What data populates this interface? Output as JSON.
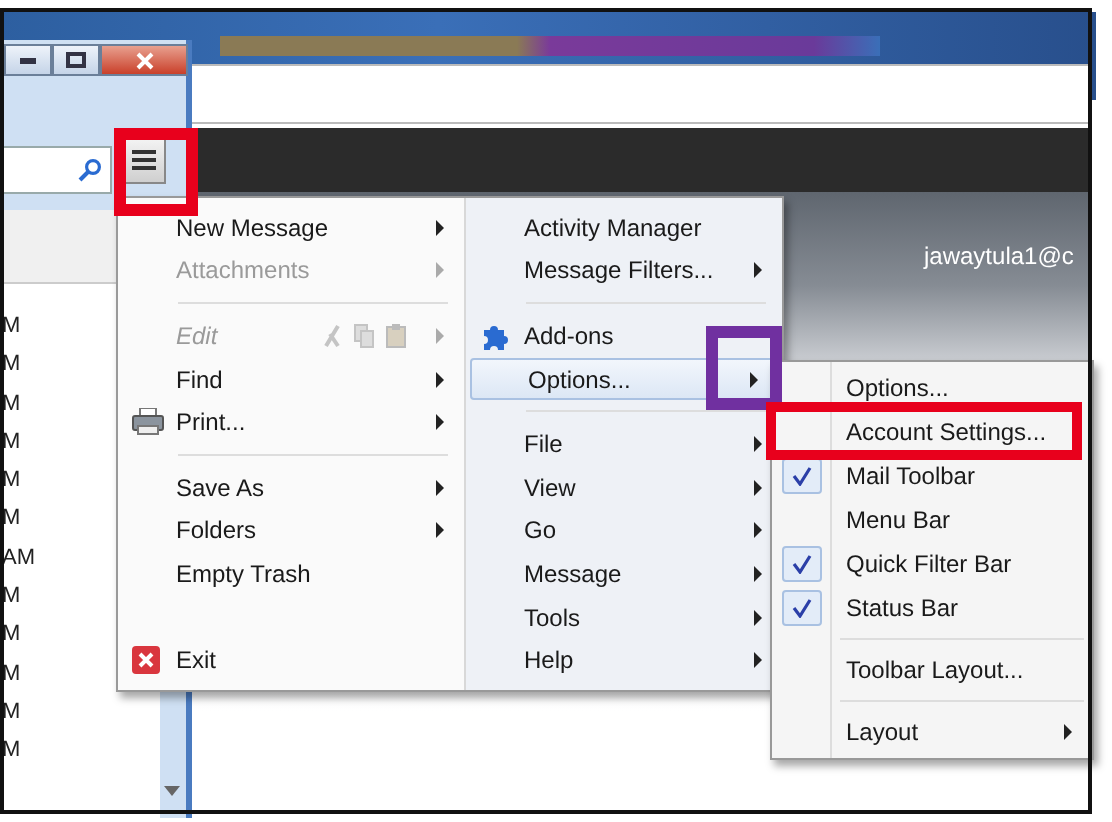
{
  "account_label": "jawaytula1@c",
  "message_list": {
    "rows": [
      "M",
      "M",
      "M",
      "M",
      "M",
      "M",
      "AM",
      "M",
      "M",
      "M",
      "M",
      "M"
    ]
  },
  "menu": {
    "left": [
      {
        "kind": "item",
        "label": "New Message",
        "arrow": true,
        "disabled": false,
        "selected": false
      },
      {
        "kind": "item",
        "label": "Attachments",
        "arrow": true,
        "disabled": true,
        "selected": false
      },
      {
        "kind": "separator"
      },
      {
        "kind": "edit",
        "label": "Edit",
        "arrow": true,
        "disabled": true,
        "selected": false
      },
      {
        "kind": "item",
        "label": "Find",
        "arrow": true,
        "disabled": false,
        "selected": false
      },
      {
        "kind": "print",
        "label": "Print...",
        "arrow": true,
        "disabled": false,
        "selected": false
      },
      {
        "kind": "separator"
      },
      {
        "kind": "item",
        "label": "Save As",
        "arrow": true,
        "disabled": false,
        "selected": false
      },
      {
        "kind": "item",
        "label": "Folders",
        "arrow": true,
        "disabled": false,
        "selected": false
      },
      {
        "kind": "item",
        "label": "Empty Trash",
        "arrow": false,
        "disabled": false,
        "selected": false
      },
      {
        "kind": "exit",
        "label": "Exit",
        "arrow": false,
        "disabled": false,
        "selected": false
      }
    ],
    "right": [
      {
        "kind": "item",
        "label": "Activity Manager",
        "arrow": false,
        "disabled": false,
        "selected": false
      },
      {
        "kind": "item",
        "label": "Message Filters...",
        "arrow": true,
        "disabled": false,
        "selected": false
      },
      {
        "kind": "separator"
      },
      {
        "kind": "addons",
        "label": "Add-ons",
        "arrow": false,
        "disabled": false,
        "selected": false
      },
      {
        "kind": "item",
        "label": "Options...",
        "arrow": true,
        "disabled": false,
        "selected": true
      },
      {
        "kind": "separator"
      },
      {
        "kind": "item",
        "label": "File",
        "arrow": true,
        "disabled": false,
        "selected": false
      },
      {
        "kind": "item",
        "label": "View",
        "arrow": true,
        "disabled": false,
        "selected": false
      },
      {
        "kind": "item",
        "label": "Go",
        "arrow": true,
        "disabled": false,
        "selected": false
      },
      {
        "kind": "item",
        "label": "Message",
        "arrow": true,
        "disabled": false,
        "selected": false
      },
      {
        "kind": "item",
        "label": "Tools",
        "arrow": true,
        "disabled": false,
        "selected": false
      },
      {
        "kind": "item",
        "label": "Help",
        "arrow": true,
        "disabled": false,
        "selected": false
      }
    ]
  },
  "submenu": {
    "items": [
      {
        "kind": "item",
        "label": "Options...",
        "checked": false,
        "arrow": false,
        "selected": false
      },
      {
        "kind": "item",
        "label": "Account Settings...",
        "checked": false,
        "arrow": false,
        "selected": false
      },
      {
        "kind": "item",
        "label": "Mail Toolbar",
        "checked": true,
        "arrow": false,
        "selected": false
      },
      {
        "kind": "item",
        "label": "Menu Bar",
        "checked": false,
        "arrow": false,
        "selected": false
      },
      {
        "kind": "item",
        "label": "Quick Filter Bar",
        "checked": true,
        "arrow": false,
        "selected": false
      },
      {
        "kind": "item",
        "label": "Status Bar",
        "checked": true,
        "arrow": false,
        "selected": false
      },
      {
        "kind": "separator"
      },
      {
        "kind": "item",
        "label": "Toolbar Layout...",
        "checked": false,
        "arrow": false,
        "selected": false
      },
      {
        "kind": "separator"
      },
      {
        "kind": "item",
        "label": "Layout",
        "checked": false,
        "arrow": true,
        "selected": false
      }
    ]
  },
  "annotations": [
    {
      "color": "#e8001c"
    },
    {
      "color": "#7030a0"
    },
    {
      "color": "#e8001c"
    }
  ]
}
